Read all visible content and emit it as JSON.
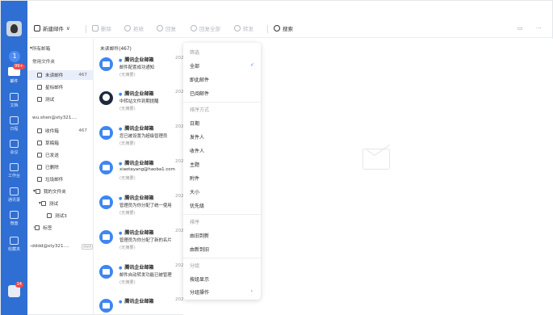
{
  "rail": {
    "unread_count": "1",
    "mail_badge": "99+",
    "items": [
      {
        "label": "邮件"
      },
      {
        "label": "文档"
      },
      {
        "label": "日程"
      },
      {
        "label": "会议"
      },
      {
        "label": "工作台"
      },
      {
        "label": "通讯录"
      },
      {
        "label": "微盘"
      },
      {
        "label": "收藏夹"
      }
    ],
    "bottom_badge": "14"
  },
  "toolbar": {
    "new_mail": "新建邮件",
    "delete": "删除",
    "reject": "拒收",
    "reply": "回复",
    "reply_all": "回复全部",
    "forward": "转发",
    "search": "搜索"
  },
  "tree": {
    "all_mailboxes": "所有邮箱",
    "common_folders": "常用文件夹",
    "unread": {
      "label": "未读邮件",
      "count": "467"
    },
    "starred": "星标邮件",
    "test": "测试",
    "account1": "wu.shen@xty321....",
    "inbox": {
      "label": "收件箱",
      "count": "467"
    },
    "drafts": "草稿箱",
    "sent": "已发送",
    "deleted": "已删除",
    "spam": "垃圾邮件",
    "my_folders": "我的文件夹",
    "test_folder": "测试",
    "test3": "测试3",
    "tags": "标签",
    "account2": "dddd@xty321....",
    "account2_tag": "IMAP"
  },
  "list": {
    "header": "未读邮件(467)",
    "mails": [
      {
        "sender": "腾讯企业邮箱",
        "date": "202",
        "subject": "邮件配置成功通知",
        "summary": "(无摘要)"
      },
      {
        "sender": "腾讯企业邮箱",
        "date": "202",
        "subject": "中转站文件到期提醒",
        "summary": "(无摘要)"
      },
      {
        "sender": "腾讯企业邮箱",
        "date": "202",
        "subject": "您已被设置为超级管理员",
        "summary": "(无摘要)"
      },
      {
        "sender": "腾讯企业邮箱",
        "date": "202",
        "subject": "xiaotayang@haoba1.com",
        "summary": "(无摘要)"
      },
      {
        "sender": "腾讯企业邮箱",
        "date": "202",
        "subject": "管理员为你分配了统一使用",
        "summary": "(无摘要)"
      },
      {
        "sender": "腾讯企业邮箱",
        "date": "202",
        "subject": "管理员为你分配了新的名片",
        "summary": "(无摘要)"
      },
      {
        "sender": "腾讯企业邮箱",
        "date": "202",
        "subject": "邮件自动转发功能已被管理",
        "summary": "(无摘要)"
      },
      {
        "sender": "腾讯企业邮箱",
        "date": "202",
        "subject": "",
        "summary": ""
      }
    ]
  },
  "menu": {
    "filter_title": "筛选",
    "all": "全部",
    "unread": "即此邮件",
    "read": "已阅邮件",
    "sort_title": "排序方式",
    "date": "日期",
    "sender": "发件人",
    "recipient": "收件人",
    "subject": "主题",
    "attachment": "附件",
    "size": "大小",
    "priority": "优先级",
    "order_title": "排序",
    "newest": "由旧到新",
    "oldest": "由新到旧",
    "group_title": "分组",
    "group_display": "按组显示",
    "group_ops": "分组操作",
    "check": "✓",
    "chevron": "›"
  },
  "colors": {
    "accent": "#2f6fd3",
    "rail": "#2f6fd3",
    "badge": "#f04c4c"
  }
}
